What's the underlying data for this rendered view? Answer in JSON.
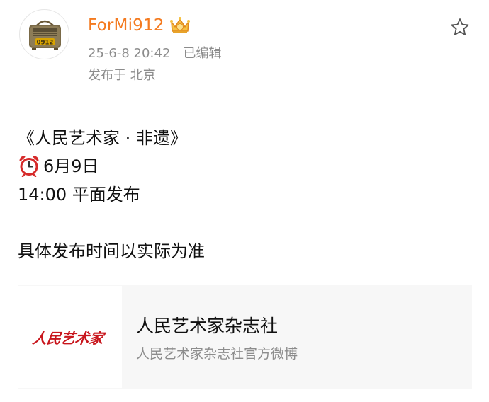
{
  "post": {
    "author": {
      "username": "ForMi912",
      "avatar_icon": "radio-icon",
      "avatar_text": "0912",
      "badge_icon": "vip-crown-icon"
    },
    "timestamp": "25-6-8 20:42",
    "edited_label": "已编辑",
    "location": "发布于 北京",
    "favorite_icon": "star-outline-icon",
    "content": {
      "line1": "《人民艺术家 · 非遗》",
      "line2_icon": "alarm-clock-icon",
      "line2": "6月9日",
      "line3": "14:00 平面发布",
      "line4": "具体发布时间以实际为准"
    },
    "link_card": {
      "logo_text": "人民艺术家",
      "title": "人民艺术家杂志社",
      "subtitle": "人民艺术家杂志社官方微博"
    }
  },
  "colors": {
    "username": "#f47a1f",
    "meta": "#8c8c8c",
    "logo_red": "#c8161d",
    "card_bg": "#f7f7f7"
  }
}
